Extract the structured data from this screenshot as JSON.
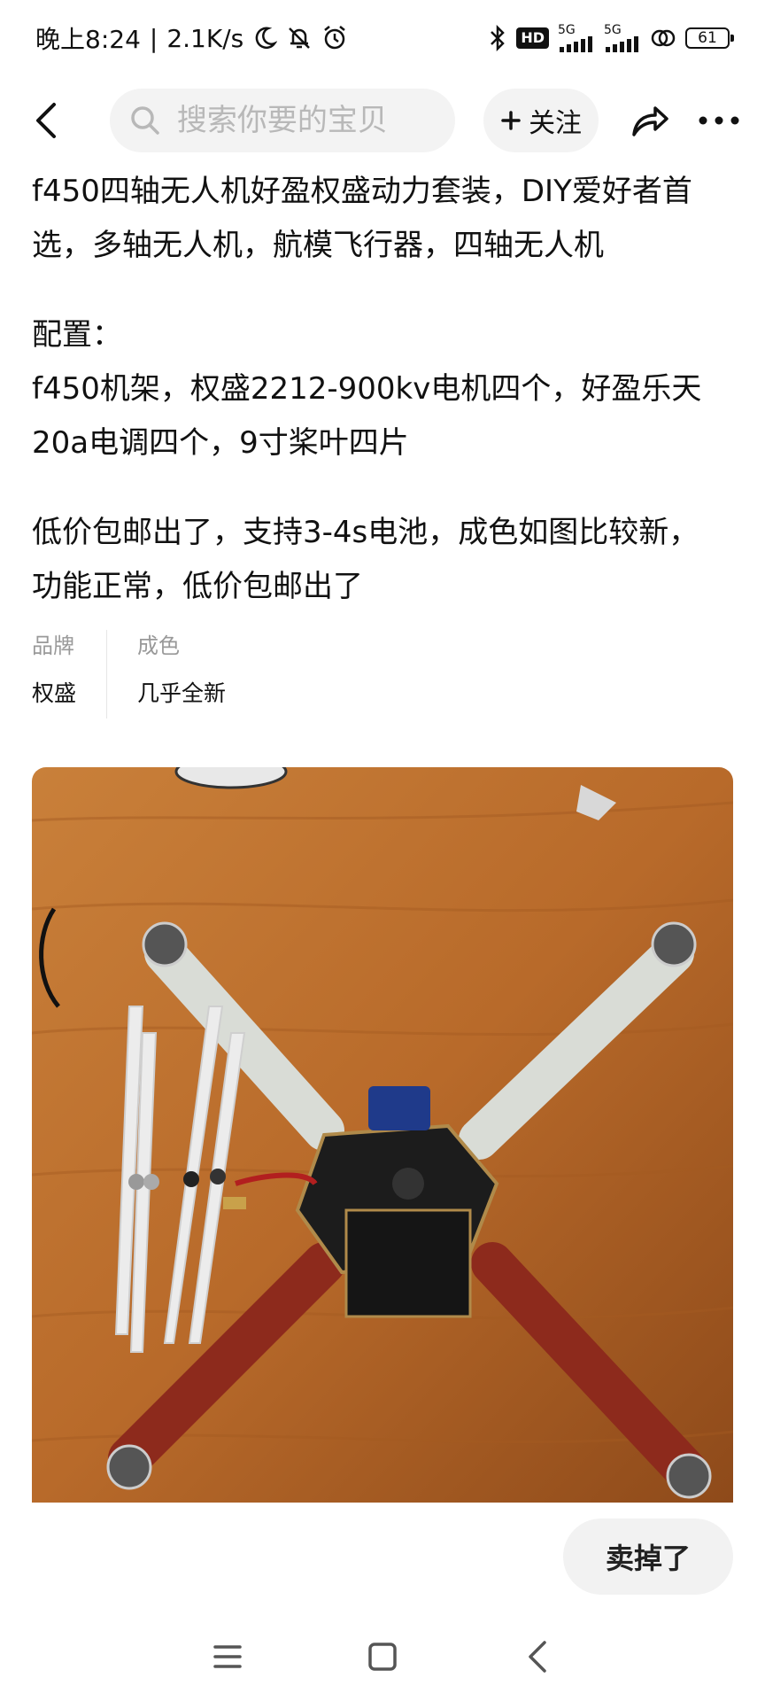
{
  "status_bar": {
    "time": "晚上8:24",
    "separator": "|",
    "net_speed": "2.1K/s",
    "hd_badge": "HD",
    "net1": "5G",
    "net2": "5G",
    "battery": "61",
    "icons": [
      "moon-icon",
      "mute-bell-icon",
      "alarm-icon",
      "bluetooth-icon",
      "signal-icon",
      "signal-icon",
      "link-icon",
      "battery-icon"
    ]
  },
  "nav": {
    "search_placeholder": "搜索你要的宝贝",
    "follow_label": "关注",
    "icons": [
      "back-icon",
      "search-icon",
      "plus-icon",
      "share-icon",
      "more-icon"
    ]
  },
  "description": {
    "title_lines": [
      "f450四轴无人机好盈权盛动力套装，DIY爱好者首",
      "选，多轴无人机，航模飞行器，四轴无人机"
    ],
    "config_lines": [
      "配置：",
      "f450机架，权盛2212-900kv电机四个，好盈乐天",
      "20a电调四个，9寸桨叶四片"
    ],
    "note_lines": [
      "低价包邮出了，支持3-4s电池，成色如图比较新，",
      "功能正常，低价包邮出了"
    ]
  },
  "attributes": [
    {
      "label": "品牌",
      "value": "权盛"
    },
    {
      "label": "成色",
      "value": "几乎全新"
    }
  ],
  "action": {
    "sold_label": "卖掉了"
  },
  "system_nav": {
    "icons": [
      "menu-icon",
      "home-icon",
      "back-nav-icon"
    ]
  },
  "colors": {
    "accent_text": "#111111",
    "muted": "#999999",
    "chip_bg": "#f3f3f3"
  }
}
